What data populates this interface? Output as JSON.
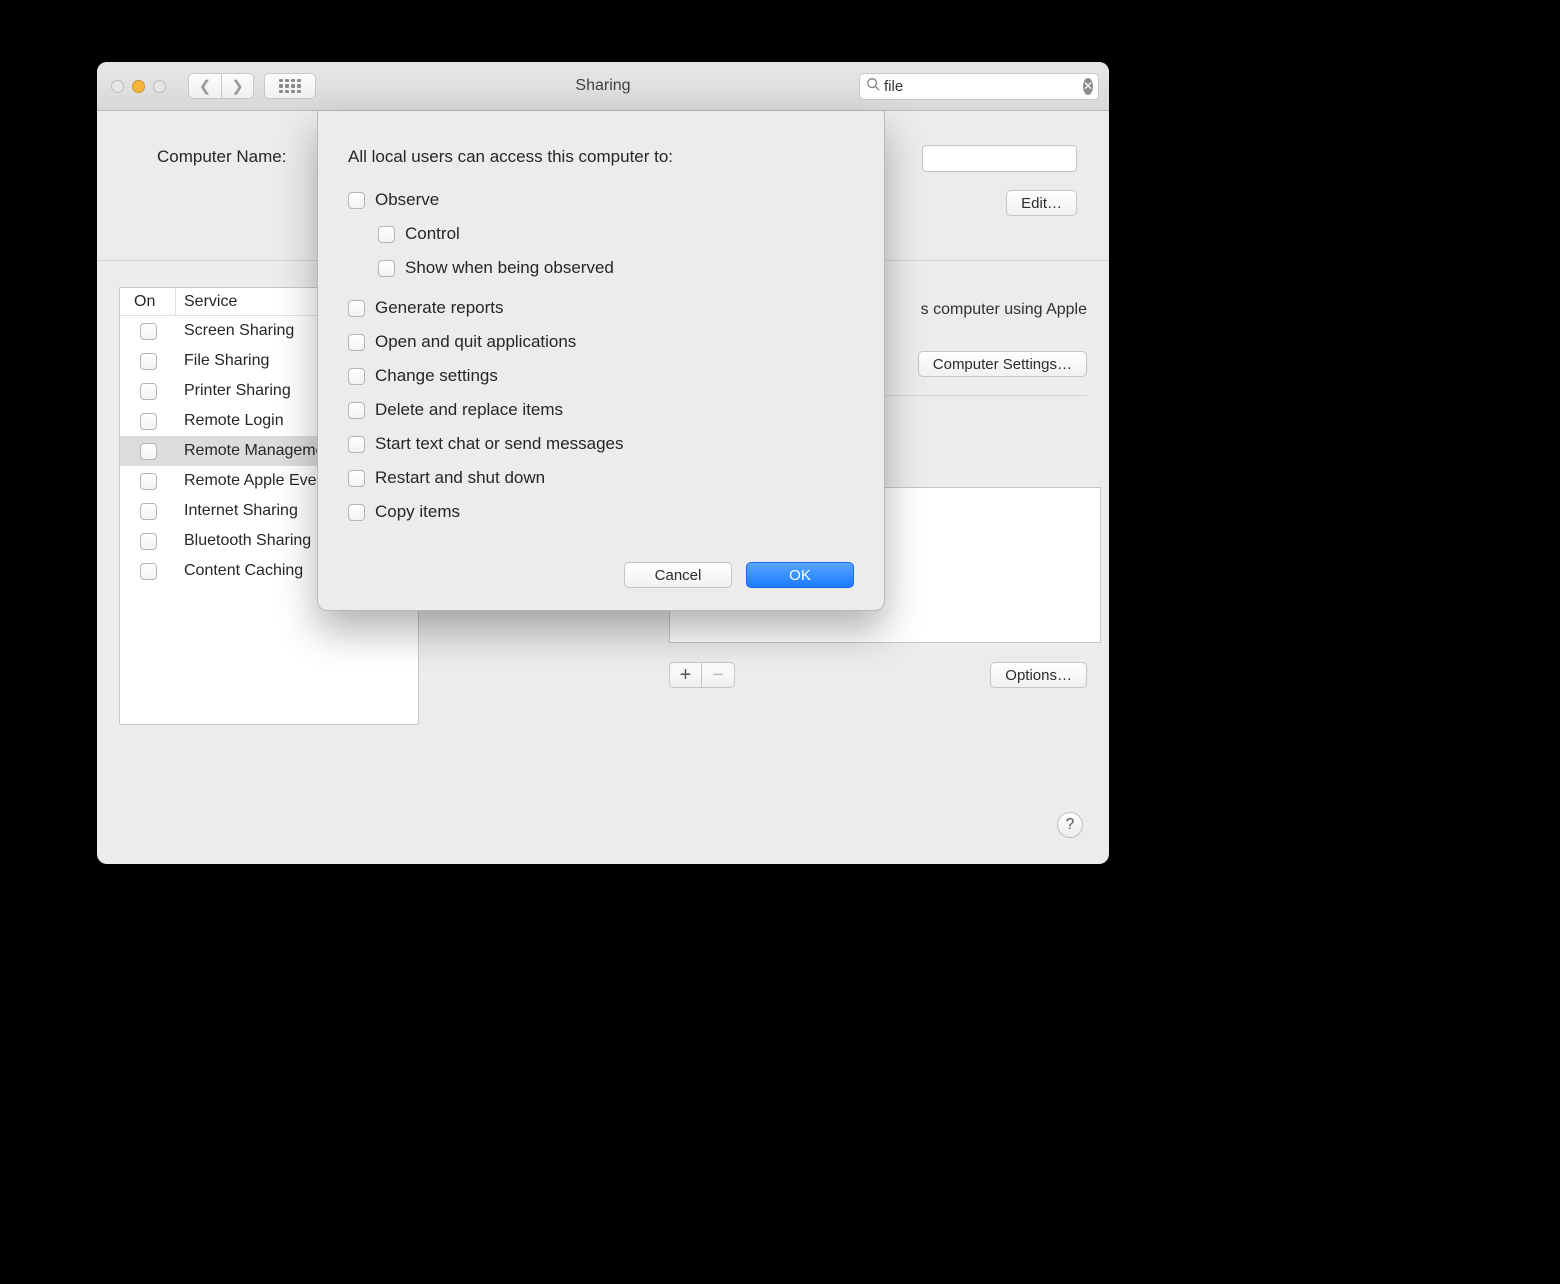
{
  "titlebar": {
    "title": "Sharing",
    "search_value": "file"
  },
  "header": {
    "computer_name_label": "Computer Name:",
    "edit_button": "Edit…"
  },
  "services": {
    "header_on": "On",
    "header_service": "Service",
    "rows": [
      {
        "label": "Screen Sharing",
        "checked": false,
        "selected": false
      },
      {
        "label": "File Sharing",
        "checked": false,
        "selected": false
      },
      {
        "label": "Printer Sharing",
        "checked": false,
        "selected": false
      },
      {
        "label": "Remote Login",
        "checked": false,
        "selected": false
      },
      {
        "label": "Remote Management",
        "checked": false,
        "selected": true
      },
      {
        "label": "Remote Apple Events",
        "checked": false,
        "selected": false
      },
      {
        "label": "Internet Sharing",
        "checked": false,
        "selected": false
      },
      {
        "label": "Bluetooth Sharing",
        "checked": false,
        "selected": false
      },
      {
        "label": "Content Caching",
        "checked": false,
        "selected": false
      }
    ]
  },
  "detail": {
    "description_fragment": "s computer using Apple",
    "computer_settings_button": "Computer Settings…",
    "options_button": "Options…"
  },
  "sheet": {
    "heading": "All local users can access this computer to:",
    "options": [
      {
        "label": "Observe",
        "indent": 0
      },
      {
        "label": "Control",
        "indent": 1
      },
      {
        "label": "Show when being observed",
        "indent": 1
      },
      {
        "label": "Generate reports",
        "indent": 0,
        "gap_before": true
      },
      {
        "label": "Open and quit applications",
        "indent": 0
      },
      {
        "label": "Change settings",
        "indent": 0
      },
      {
        "label": "Delete and replace items",
        "indent": 0
      },
      {
        "label": "Start text chat or send messages",
        "indent": 0
      },
      {
        "label": "Restart and shut down",
        "indent": 0
      },
      {
        "label": "Copy items",
        "indent": 0
      }
    ],
    "cancel": "Cancel",
    "ok": "OK"
  }
}
